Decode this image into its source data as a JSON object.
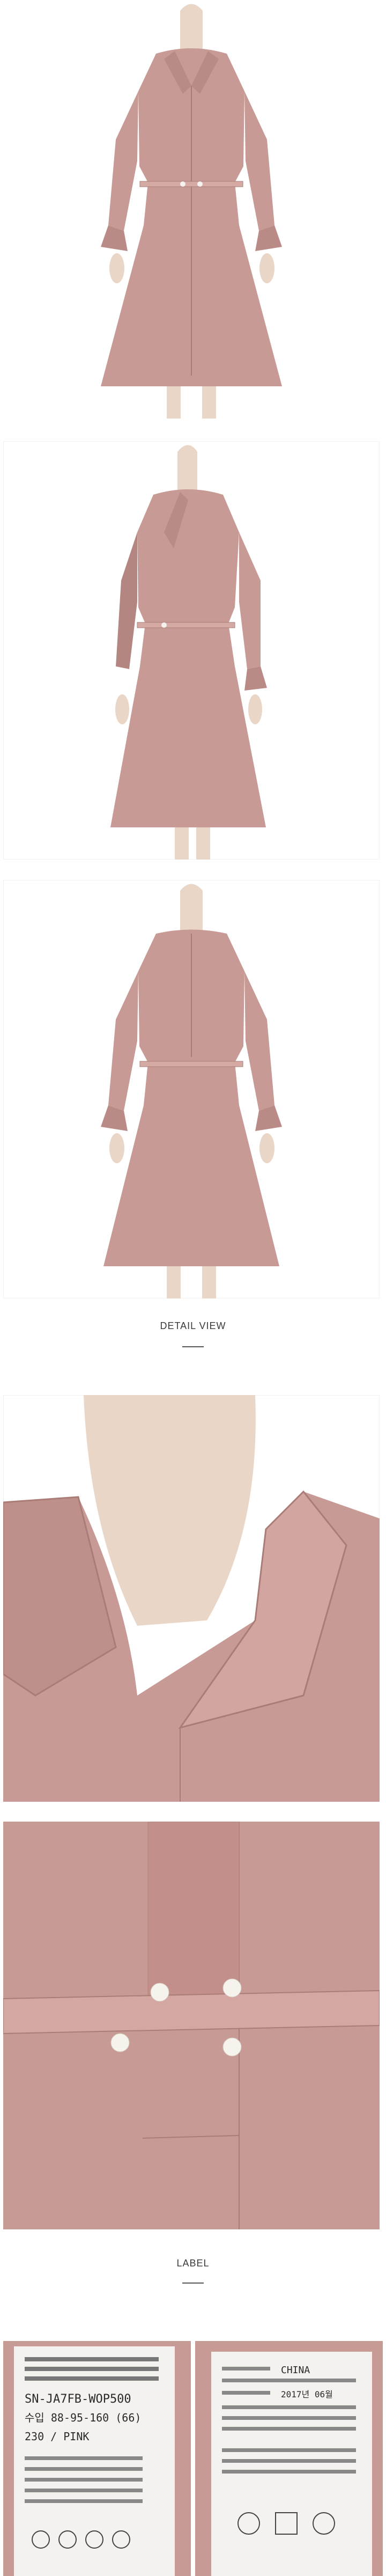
{
  "sections": {
    "detail": "DETAIL VIEW",
    "label": "LABEL"
  },
  "care_label_left": {
    "lines": [
      "SN-JA7FB-WOP500",
      "수입 88-95-160 (66)",
      "230 / PINK"
    ]
  },
  "care_label_right": {
    "lines": [
      "CHINA",
      "2017년 06월"
    ]
  },
  "colors": {
    "dress": "#c89a95",
    "dress_shadow": "#a97c78",
    "dress_highlight": "#dbb2ad",
    "skin": "#ead6c7",
    "background": "#ffffff"
  }
}
